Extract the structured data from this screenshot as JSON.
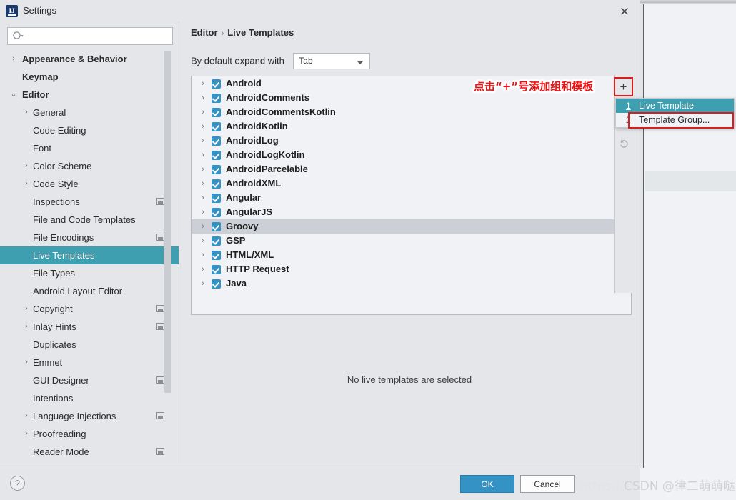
{
  "window": {
    "title": "Settings",
    "app_icon": "intellij-idea-icon",
    "close_icon": "close-icon"
  },
  "search": {
    "value": "",
    "placeholder": "",
    "icon": "search-icon"
  },
  "sidebar": {
    "items": [
      {
        "label": "Appearance & Behavior",
        "level": 0,
        "arrow": "›",
        "selected": false,
        "badge": false
      },
      {
        "label": "Keymap",
        "level": 0,
        "arrow": "",
        "selected": false,
        "badge": false
      },
      {
        "label": "Editor",
        "level": 0,
        "arrow": "⌄",
        "selected": false,
        "badge": false
      },
      {
        "label": "General",
        "level": 1,
        "arrow": "›",
        "selected": false,
        "badge": false
      },
      {
        "label": "Code Editing",
        "level": 1,
        "arrow": "",
        "selected": false,
        "badge": false
      },
      {
        "label": "Font",
        "level": 1,
        "arrow": "",
        "selected": false,
        "badge": false
      },
      {
        "label": "Color Scheme",
        "level": 1,
        "arrow": "›",
        "selected": false,
        "badge": false
      },
      {
        "label": "Code Style",
        "level": 1,
        "arrow": "›",
        "selected": false,
        "badge": false
      },
      {
        "label": "Inspections",
        "level": 1,
        "arrow": "",
        "selected": false,
        "badge": true
      },
      {
        "label": "File and Code Templates",
        "level": 1,
        "arrow": "",
        "selected": false,
        "badge": false
      },
      {
        "label": "File Encodings",
        "level": 1,
        "arrow": "",
        "selected": false,
        "badge": true
      },
      {
        "label": "Live Templates",
        "level": 1,
        "arrow": "",
        "selected": true,
        "badge": false
      },
      {
        "label": "File Types",
        "level": 1,
        "arrow": "",
        "selected": false,
        "badge": false
      },
      {
        "label": "Android Layout Editor",
        "level": 1,
        "arrow": "",
        "selected": false,
        "badge": false
      },
      {
        "label": "Copyright",
        "level": 1,
        "arrow": "›",
        "selected": false,
        "badge": true
      },
      {
        "label": "Inlay Hints",
        "level": 1,
        "arrow": "›",
        "selected": false,
        "badge": true
      },
      {
        "label": "Duplicates",
        "level": 1,
        "arrow": "",
        "selected": false,
        "badge": false
      },
      {
        "label": "Emmet",
        "level": 1,
        "arrow": "›",
        "selected": false,
        "badge": false
      },
      {
        "label": "GUI Designer",
        "level": 1,
        "arrow": "",
        "selected": false,
        "badge": true
      },
      {
        "label": "Intentions",
        "level": 1,
        "arrow": "",
        "selected": false,
        "badge": false
      },
      {
        "label": "Language Injections",
        "level": 1,
        "arrow": "›",
        "selected": false,
        "badge": true
      },
      {
        "label": "Proofreading",
        "level": 1,
        "arrow": "›",
        "selected": false,
        "badge": false
      },
      {
        "label": "Reader Mode",
        "level": 1,
        "arrow": "",
        "selected": false,
        "badge": true
      }
    ]
  },
  "content": {
    "breadcrumb": {
      "root": "Editor",
      "separator": "›",
      "current": "Live Templates"
    },
    "expand_with": {
      "label": "By default expand with",
      "selected_value": "Tab",
      "caret_icon": "chevron-down-icon"
    },
    "template_groups": [
      {
        "name": "Android",
        "checked": true,
        "selected": false
      },
      {
        "name": "AndroidComments",
        "checked": true,
        "selected": false
      },
      {
        "name": "AndroidCommentsKotlin",
        "checked": true,
        "selected": false
      },
      {
        "name": "AndroidKotlin",
        "checked": true,
        "selected": false
      },
      {
        "name": "AndroidLog",
        "checked": true,
        "selected": false
      },
      {
        "name": "AndroidLogKotlin",
        "checked": true,
        "selected": false
      },
      {
        "name": "AndroidParcelable",
        "checked": true,
        "selected": false
      },
      {
        "name": "AndroidXML",
        "checked": true,
        "selected": false
      },
      {
        "name": "Angular",
        "checked": true,
        "selected": false
      },
      {
        "name": "AngularJS",
        "checked": true,
        "selected": false
      },
      {
        "name": "Groovy",
        "checked": true,
        "selected": true
      },
      {
        "name": "GSP",
        "checked": true,
        "selected": false
      },
      {
        "name": "HTML/XML",
        "checked": true,
        "selected": false
      },
      {
        "name": "HTTP Request",
        "checked": true,
        "selected": false
      },
      {
        "name": "Java",
        "checked": true,
        "selected": false
      }
    ],
    "empty_message": "No live templates are selected",
    "toolbar": {
      "add_label": "+",
      "add_icon": "plus-icon",
      "revert_icon": "undo-arrow-icon"
    }
  },
  "popup_menu": {
    "items": [
      {
        "number": "1",
        "label": "Live Template",
        "highlighted": true
      },
      {
        "number": "2",
        "label": "Template Group...",
        "highlighted": false
      }
    ]
  },
  "annotation": {
    "text": "点击“+”号添加组和模板",
    "color": "#ee1111"
  },
  "bottom": {
    "help_label": "?",
    "ok_label": "OK",
    "cancel_label": "Cancel"
  },
  "watermark": {
    "prefix": "https://",
    "text": "CSDN @律二萌萌哒"
  },
  "colors": {
    "accent": "#3d9fb0",
    "checkbox": "#3592c4",
    "ok_button": "#3592c4",
    "annotation_red": "#ee1111",
    "dialog_bg": "#e4e6ea",
    "list_bg": "#f1f2f5"
  }
}
